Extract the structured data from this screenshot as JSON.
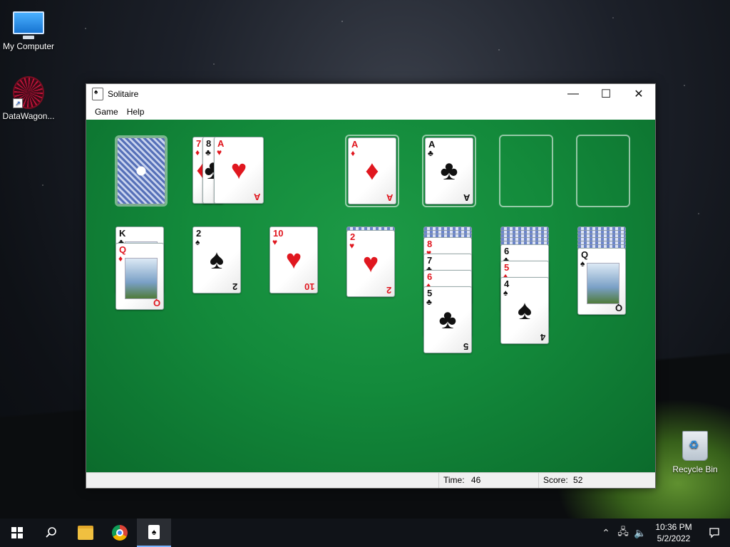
{
  "desktop": {
    "icons": [
      {
        "label": "My Computer",
        "icon": "computer-icon"
      },
      {
        "label": "DataWagon...",
        "icon": "datawagon-icon"
      },
      {
        "label": "Recycle Bin",
        "icon": "recycle-bin-icon"
      }
    ]
  },
  "window": {
    "title": "Solitaire",
    "controls": {
      "minimize": "—",
      "maximize": "☐",
      "close": "✕"
    },
    "menu": [
      "Game",
      "Help"
    ]
  },
  "game": {
    "waste": [
      {
        "rank": "7",
        "suit": "♦",
        "color": "red"
      },
      {
        "rank": "8",
        "suit": "♣",
        "color": "black"
      },
      {
        "rank": "A",
        "suit": "♥",
        "color": "red"
      }
    ],
    "foundations": [
      {
        "rank": "A",
        "suit": "♦",
        "color": "red"
      },
      {
        "rank": "A",
        "suit": "♣",
        "color": "black"
      },
      null,
      null
    ],
    "tableau": [
      {
        "face_down": 0,
        "cards": [
          {
            "rank": "K",
            "suit": "♣",
            "color": "black"
          },
          {
            "rank": "Q",
            "suit": "♦",
            "color": "red"
          }
        ]
      },
      {
        "face_down": 0,
        "cards": [
          {
            "rank": "2",
            "suit": "♠",
            "color": "black"
          }
        ]
      },
      {
        "face_down": 0,
        "cards": [
          {
            "rank": "10",
            "suit": "♥",
            "color": "red"
          }
        ]
      },
      {
        "face_down": 1,
        "cards": [
          {
            "rank": "2",
            "suit": "♥",
            "color": "red"
          }
        ]
      },
      {
        "face_down": 3,
        "cards": [
          {
            "rank": "8",
            "suit": "♥",
            "color": "red"
          },
          {
            "rank": "7",
            "suit": "♣",
            "color": "black"
          },
          {
            "rank": "6",
            "suit": "♦",
            "color": "red"
          },
          {
            "rank": "5",
            "suit": "♣",
            "color": "black"
          }
        ]
      },
      {
        "face_down": 5,
        "cards": [
          {
            "rank": "6",
            "suit": "♣",
            "color": "black"
          },
          {
            "rank": "5",
            "suit": "♦",
            "color": "red"
          },
          {
            "rank": "4",
            "suit": "♠",
            "color": "black"
          }
        ]
      },
      {
        "face_down": 6,
        "cards": [
          {
            "rank": "Q",
            "suit": "♠",
            "color": "black"
          }
        ]
      }
    ]
  },
  "status": {
    "time_label": "Time:",
    "time_value": "46",
    "score_label": "Score:",
    "score_value": "52"
  },
  "taskbar": {
    "time": "10:36 PM",
    "date": "5/2/2022"
  }
}
